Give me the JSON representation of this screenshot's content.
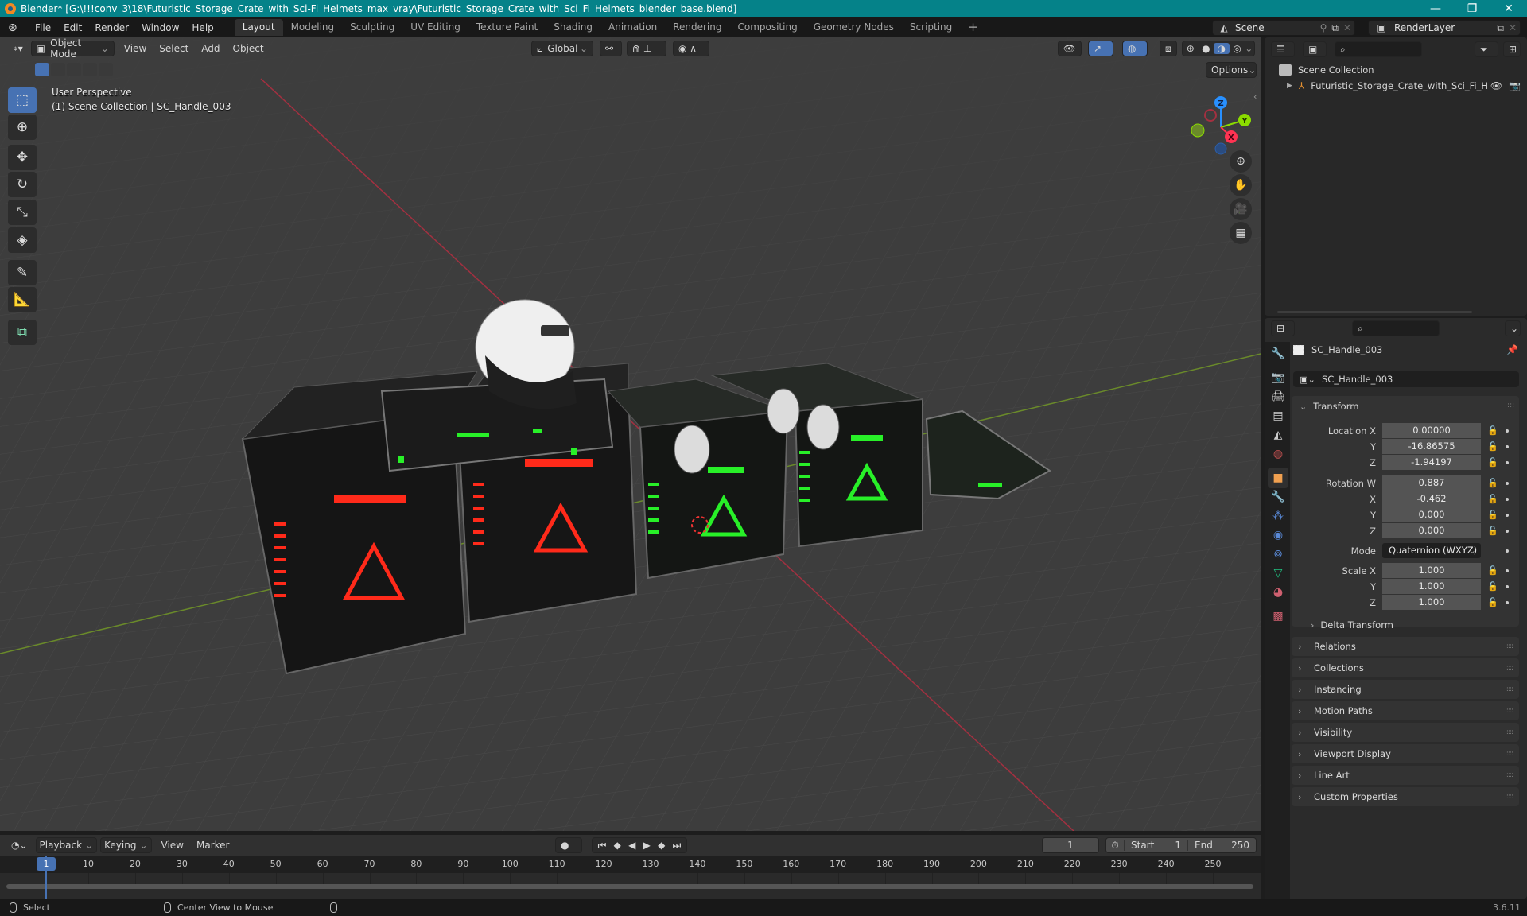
{
  "window": {
    "title": "Blender* [G:\\!!!conv_3\\18\\Futuristic_Storage_Crate_with_Sci-Fi_Helmets_max_vray\\Futuristic_Storage_Crate_with_Sci_Fi_Helmets_blender_base.blend]",
    "minimize": "—",
    "maximize": "❐",
    "close": "✕"
  },
  "menu": {
    "items": [
      "File",
      "Edit",
      "Render",
      "Window",
      "Help"
    ],
    "workspaces": [
      "Layout",
      "Modeling",
      "Sculpting",
      "UV Editing",
      "Texture Paint",
      "Shading",
      "Animation",
      "Rendering",
      "Compositing",
      "Geometry Nodes",
      "Scripting"
    ],
    "active_workspace": "Layout",
    "add_workspace": "+",
    "scene": "Scene",
    "view_layer": "RenderLayer"
  },
  "viewport": {
    "mode": "Object Mode",
    "menus": [
      "View",
      "Select",
      "Add",
      "Object"
    ],
    "transform_orientation": "Global",
    "options_label": "Options",
    "overlay_line1": "User Perspective",
    "overlay_line2": "(1) Scene Collection | SC_Handle_003",
    "gizmo_axes": {
      "x": "X",
      "y": "Y",
      "z": "Z"
    },
    "axis_colors": {
      "x": "#ff3352",
      "y": "#8bdc00",
      "z": "#2890ff"
    },
    "tools": [
      "select-box",
      "cursor",
      "move",
      "rotate",
      "scale",
      "transform",
      "annotate",
      "measure",
      "add-cube"
    ],
    "active_tool": "select-box",
    "shading_mode": "material-preview",
    "scene_objects": [
      "Futuristic storage crates (red x2, green x2)",
      "Sci-fi helmet"
    ]
  },
  "outliner": {
    "root": "Scene Collection",
    "items": [
      {
        "name": "Futuristic_Storage_Crate_with_Sci_Fi_H",
        "visible": true,
        "renderable": true
      }
    ]
  },
  "properties": {
    "object_name": "SC_Handle_003",
    "data_name": "SC_Handle_003",
    "transform_label": "Transform",
    "location": {
      "label": "Location X",
      "x": "0.00000",
      "y": "-16.86575",
      "z": "-1.94197"
    },
    "rotation": {
      "label": "Rotation W",
      "w": "0.887",
      "x": "-0.462",
      "y": "0.000",
      "z": "0.000"
    },
    "mode_label": "Mode",
    "rotation_mode": "Quaternion (WXYZ)",
    "scale": {
      "label": "Scale X",
      "x": "1.000",
      "y": "1.000",
      "z": "1.000"
    },
    "axis_labels": {
      "y": "Y",
      "z": "Z",
      "x": "X"
    },
    "delta_transform": "Delta Transform",
    "panels": [
      "Relations",
      "Collections",
      "Instancing",
      "Motion Paths",
      "Visibility",
      "Viewport Display",
      "Line Art",
      "Custom Properties"
    ]
  },
  "timeline": {
    "menus": [
      "Playback",
      "Keying",
      "View",
      "Marker"
    ],
    "current_frame": "1",
    "start_label": "Start",
    "start": "1",
    "end_label": "End",
    "end": "250",
    "ticks": [
      "1",
      "10",
      "20",
      "30",
      "40",
      "50",
      "60",
      "70",
      "80",
      "90",
      "100",
      "110",
      "120",
      "130",
      "140",
      "150",
      "160",
      "170",
      "180",
      "190",
      "200",
      "210",
      "220",
      "230",
      "240",
      "250"
    ]
  },
  "statusbar": {
    "left_hint": "Select",
    "middle_hint": "Center View to Mouse",
    "version": "3.6.11"
  }
}
